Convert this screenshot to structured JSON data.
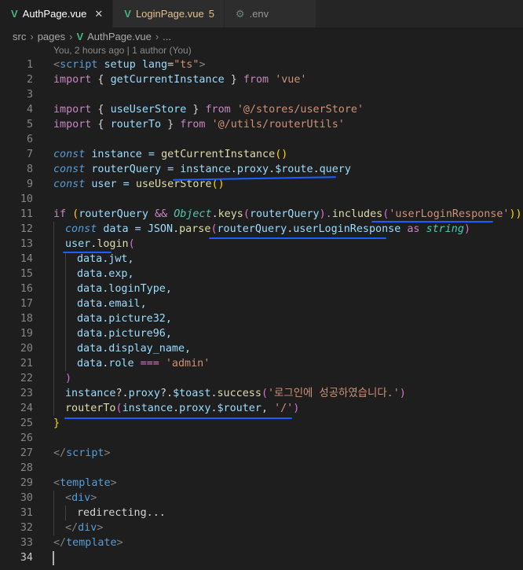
{
  "tabs": [
    {
      "label": "AuthPage.vue",
      "active": true,
      "close": "✕"
    },
    {
      "label": "LoginPage.vue",
      "badge": "5"
    },
    {
      "label": ".env"
    }
  ],
  "breadcrumb": [
    "src",
    "pages",
    "AuthPage.vue",
    "..."
  ],
  "blame": "You, 2 hours ago | 1 author (You)",
  "line_numbers": [
    "1",
    "2",
    "3",
    "4",
    "5",
    "6",
    "7",
    "8",
    "9",
    "10",
    "11",
    "12",
    "13",
    "14",
    "15",
    "16",
    "17",
    "18",
    "19",
    "20",
    "21",
    "22",
    "23",
    "24",
    "25",
    "26",
    "27",
    "28",
    "29",
    "30",
    "31",
    "32",
    "33",
    "34"
  ],
  "code": {
    "l1": [
      "<",
      "script",
      " setup",
      " lang",
      "=",
      "\"ts\"",
      ">"
    ],
    "l2": [
      "import",
      " { ",
      "getCurrentInstance",
      " } ",
      "from",
      " ",
      "'vue'"
    ],
    "l4": [
      "import",
      " { ",
      "useUserStore",
      " } ",
      "from",
      " ",
      "'@/stores/userStore'"
    ],
    "l5": [
      "import",
      " { ",
      "routerTo",
      " } ",
      "from",
      " ",
      "'@/utils/routerUtils'"
    ],
    "l7": [
      "const",
      " instance = ",
      "getCurrentInstance",
      "()"
    ],
    "l8": [
      "const",
      " routerQuery = ",
      "instance",
      ".",
      "proxy",
      ".",
      "$route",
      ".",
      "query"
    ],
    "l9": [
      "const",
      " user = ",
      "useUserStore",
      "()"
    ],
    "l11": [
      "if",
      " (",
      "routerQuery",
      " && ",
      "Object",
      ".",
      "keys",
      "(",
      "routerQuery",
      ").",
      "includes",
      "(",
      "'userLoginResponse'",
      ")) {"
    ],
    "l12": [
      "const",
      " data = ",
      "JSON",
      ".",
      "parse",
      "(",
      "routerQuery",
      ".",
      "userLoginResponse",
      " as ",
      "string",
      ")"
    ],
    "l13": [
      "user",
      ".",
      "login",
      "("
    ],
    "l14": "data.jwt,",
    "l15": "data.exp,",
    "l16": "data.loginType,",
    "l17": "data.email,",
    "l18": "data.picture32,",
    "l19": "data.picture96,",
    "l20": "data.display_name,",
    "l21": [
      "data",
      ".",
      "role",
      " === ",
      "'admin'"
    ],
    "l22": ")",
    "l23": [
      "instance",
      "?.",
      "proxy",
      "?.",
      "$toast",
      ".",
      "success",
      "(",
      "'로그인에 성공하였습니다.'",
      ")"
    ],
    "l24": [
      "routerTo",
      "(",
      "instance",
      ".",
      "proxy",
      ".",
      "$router",
      ", ",
      "'/'",
      ")"
    ],
    "l25": "}",
    "l27": [
      "</",
      "script",
      ">"
    ],
    "l29": [
      "<",
      "template",
      ">"
    ],
    "l30": [
      "<",
      "div",
      ">"
    ],
    "l31": "redirecting...",
    "l32": [
      "</",
      "div",
      ">"
    ],
    "l33": [
      "</",
      "template",
      ">"
    ]
  },
  "colors": {
    "background": "#1e1e1e",
    "keyword": "#c586c0",
    "string": "#ce9178",
    "function": "#dcdcaa",
    "variable": "#9cdcfe",
    "tag": "#569cd6",
    "type": "#4ec9b0",
    "annotation_underline": "#1a5fff"
  },
  "icons": {
    "vue_tab": "vue-logo-icon",
    "env_tab": "gear-icon"
  }
}
